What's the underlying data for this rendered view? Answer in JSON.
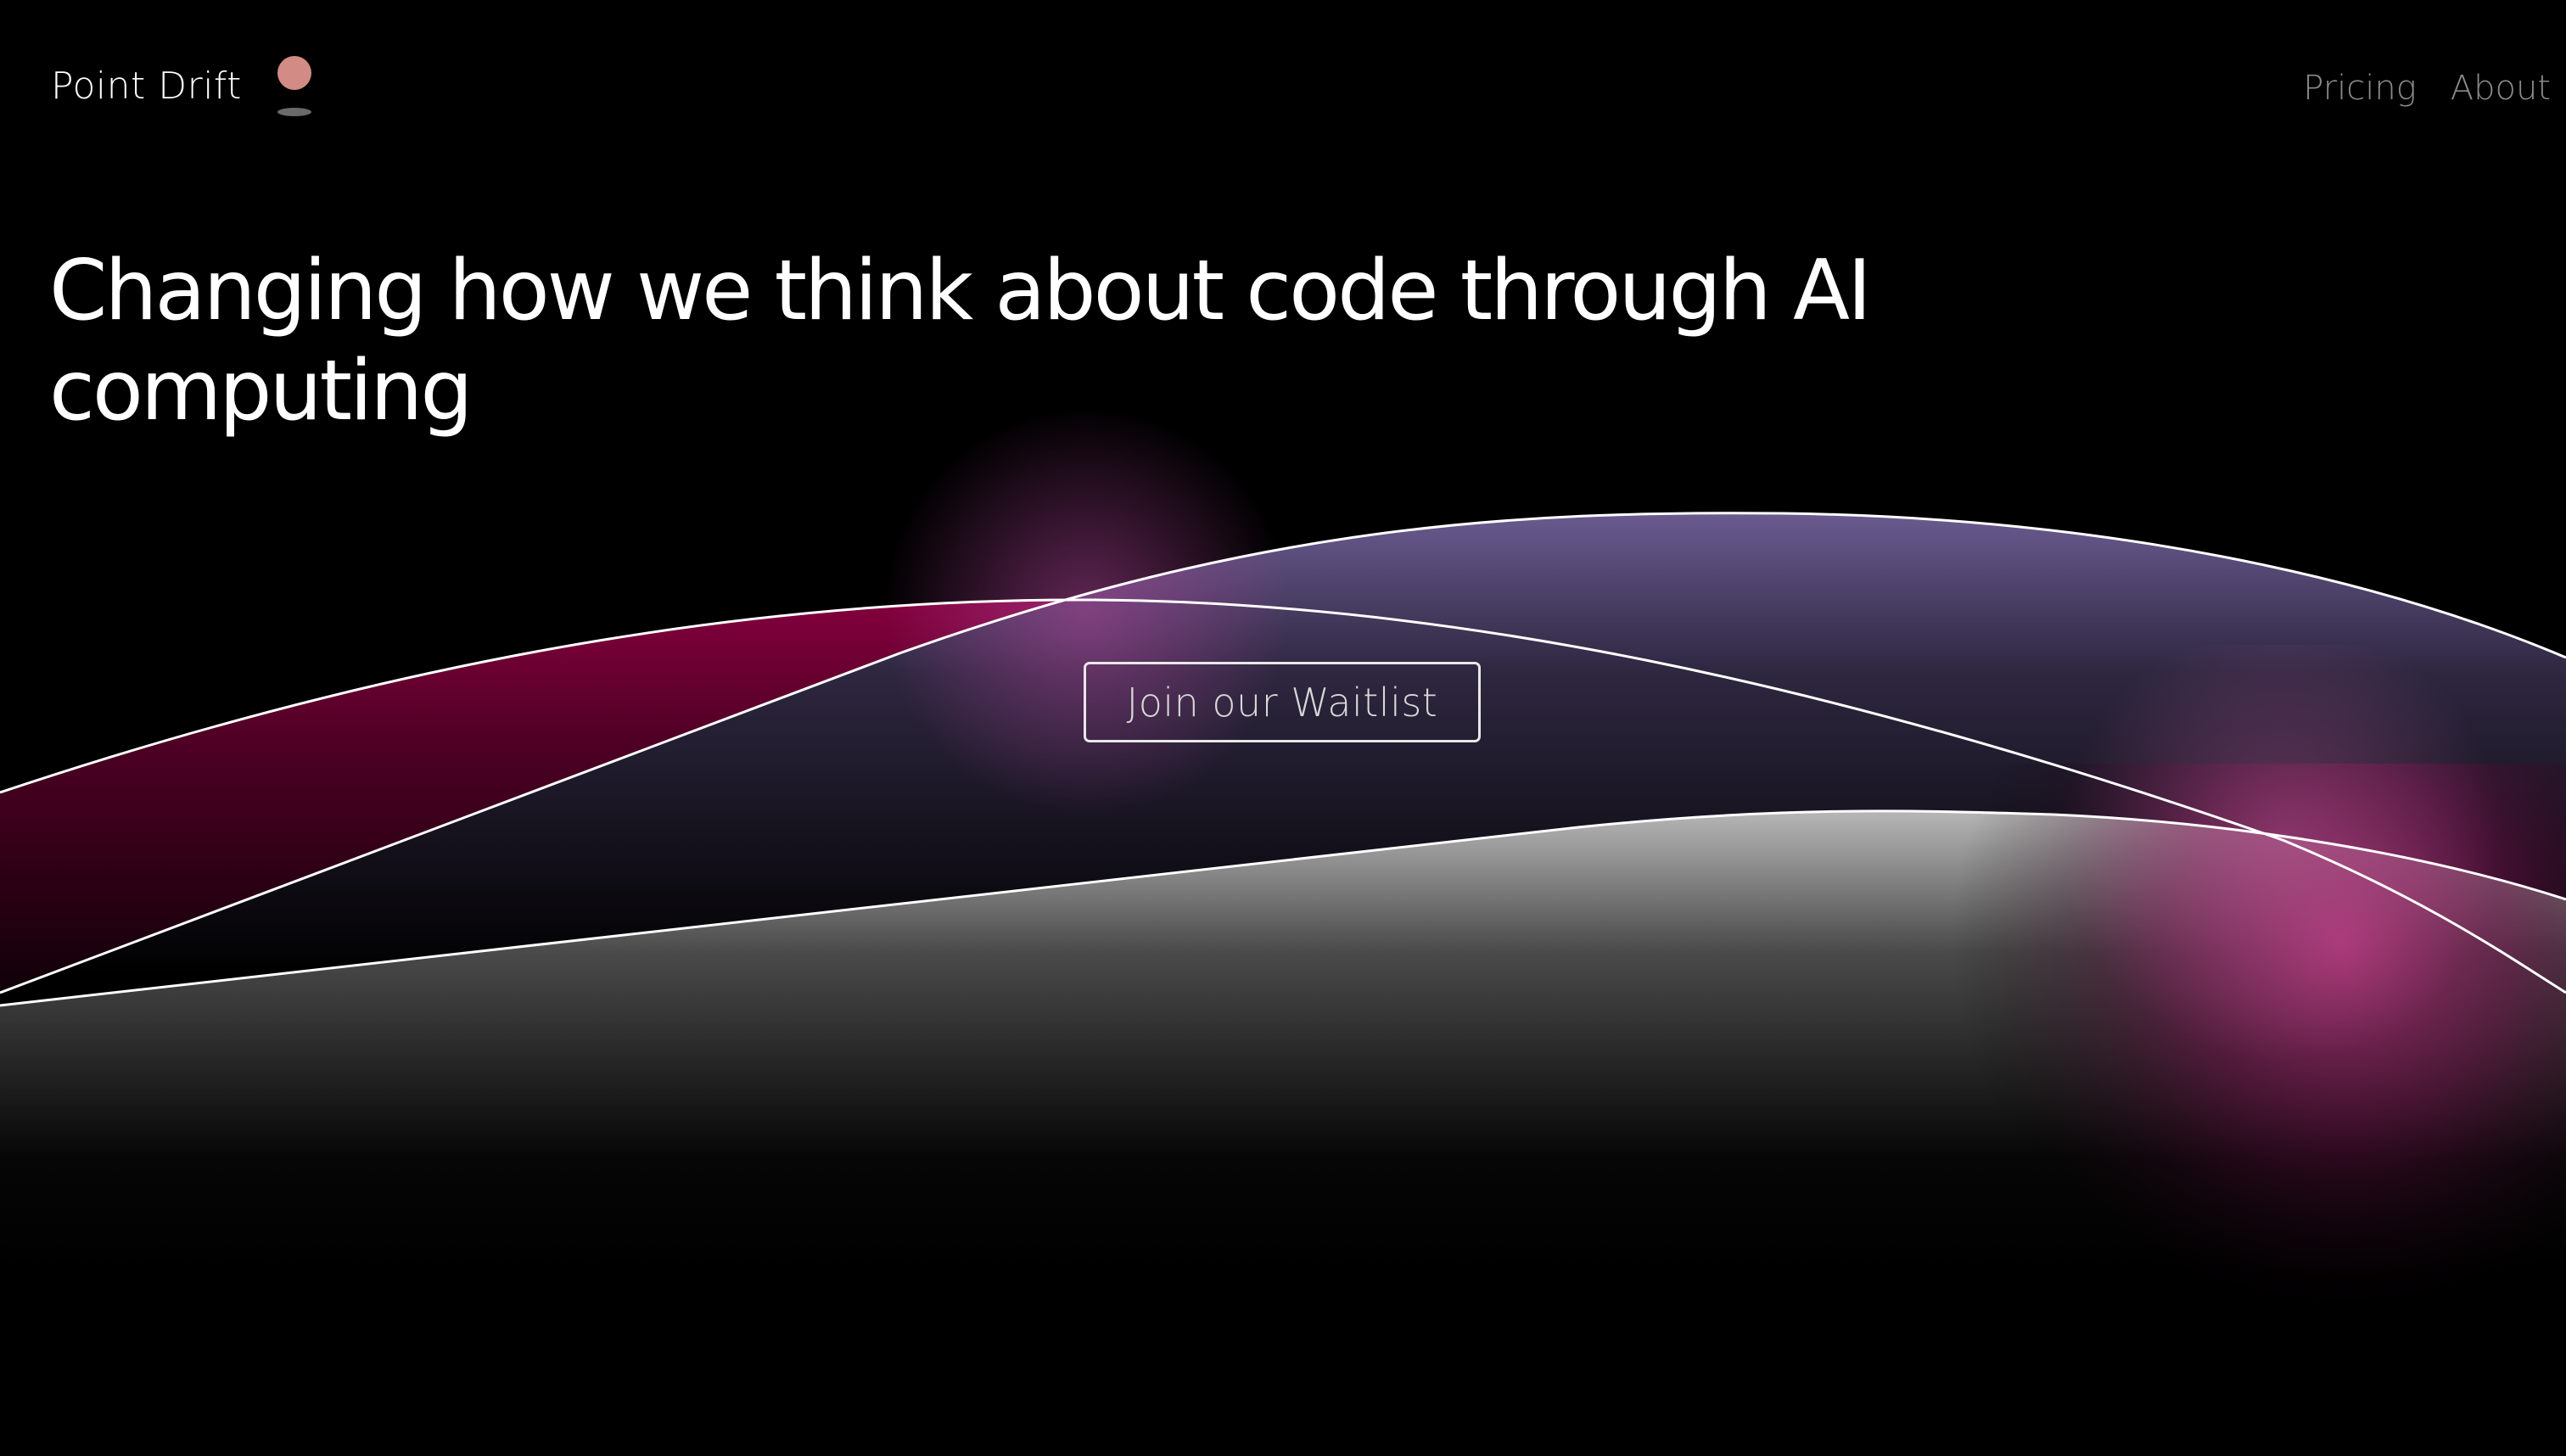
{
  "header": {
    "brand_name": "Point Drift",
    "nav": [
      {
        "label": "Pricing"
      },
      {
        "label": "About"
      }
    ]
  },
  "hero": {
    "title": "Changing how we think about code through AI computing",
    "cta_label": "Join our Waitlist"
  },
  "colors": {
    "background": "#000000",
    "text": "#ffffff",
    "nav_text": "#8a8a8a",
    "logo_dot": "#d38b86",
    "wave_magenta": "#a0004a",
    "wave_violet": "#7e6aa8",
    "wave_silver": "#c4c4c4",
    "wave_outline": "#ffffff"
  }
}
